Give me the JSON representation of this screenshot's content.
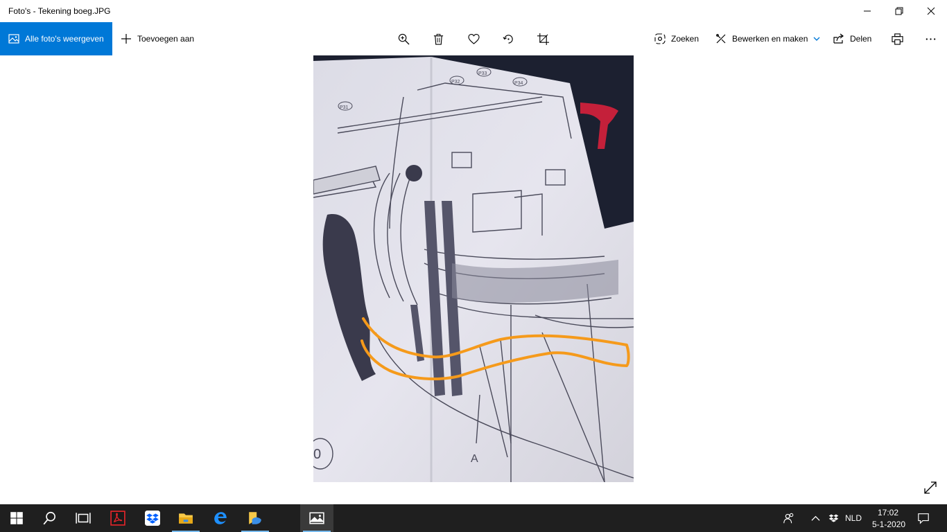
{
  "window": {
    "title": "Foto's - Tekening boeg.JPG",
    "controls": [
      "minimize",
      "restore",
      "close"
    ]
  },
  "toolbar": {
    "all_photos_label": "Alle foto's weergeven",
    "add_to_label": "Toevoegen aan",
    "search_label": "Zoeken",
    "edit_label": "Bewerken en maken",
    "share_label": "Delen",
    "icons": [
      "zoom-icon",
      "delete-icon",
      "favorite-icon",
      "rotate-icon",
      "crop-icon",
      "print-icon",
      "more-icon"
    ]
  },
  "photo": {
    "description_labels": [
      "P31",
      "P32",
      "P33",
      "P34",
      "A",
      "0"
    ],
    "highlight_color": "#f59a1b"
  },
  "taskbar": {
    "apps": [
      "start",
      "search",
      "task-view",
      "acrobat",
      "dropbox",
      "file-explorer",
      "edge",
      "sticky-notes",
      "photos"
    ],
    "language": "NLD",
    "time": "17:02",
    "date": "5-1-2020"
  },
  "colors": {
    "accent": "#0078d7",
    "taskbar": "#1f1f1f"
  }
}
